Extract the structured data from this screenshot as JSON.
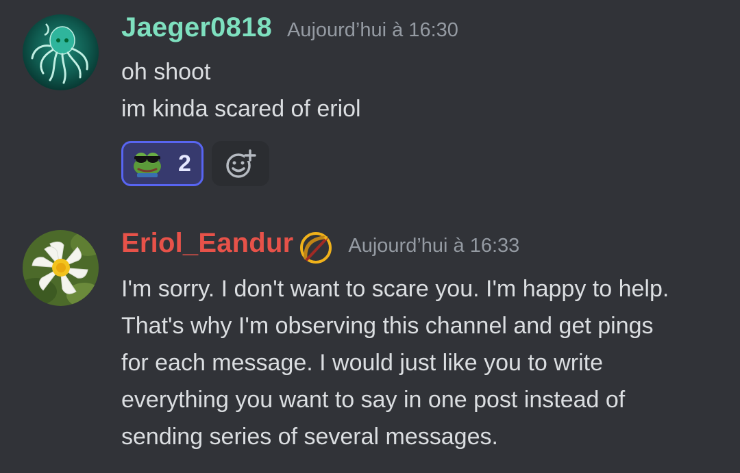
{
  "messages": [
    {
      "username": "Jaeger0818",
      "username_color": "#7ee0bf",
      "timestamp": "Aujourd’hui à 16:30",
      "avatar_icon": "octopus-avatar",
      "lines": [
        "oh shoot",
        "im kinda scared of eriol"
      ],
      "reactions": [
        {
          "emoji_icon": "pepe-sunglasses-emoji",
          "count": "2",
          "active": true
        }
      ],
      "add_reaction_icon": "add-reaction-icon"
    },
    {
      "username": "Eriol_Eandur",
      "username_color": "#e75249",
      "timestamp": "Aujourd’hui à 16:33",
      "avatar_icon": "water-lily-avatar",
      "badge_icon": "bow-badge-icon",
      "lines": [
        "I'm sorry. I don't want to scare you. I'm happy to help.",
        "That's why I'm observing this channel and get pings",
        "for each message. I would just like you to write",
        "everything you want to say in one post instead of",
        "sending series of several messages."
      ]
    }
  ],
  "colors": {
    "background": "#313338",
    "text": "#dbdee1",
    "timestamp": "#959ba3",
    "reaction_active_bg": "#373a6e",
    "reaction_active_border": "#5865f2"
  }
}
